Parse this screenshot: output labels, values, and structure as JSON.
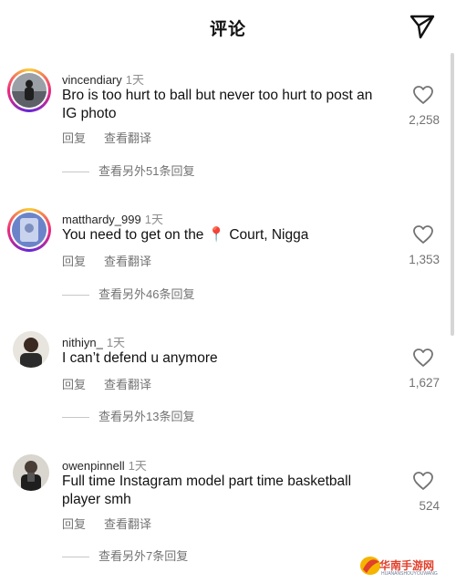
{
  "header": {
    "title": "评论"
  },
  "comments": [
    {
      "username": "vincendiary",
      "time": "1天",
      "text": "Bro is too hurt to ball but never too hurt to post an IG photo",
      "reply": "回复",
      "translate": "查看翻译",
      "likes": "2,258",
      "view_replies": "查看另外51条回复"
    },
    {
      "username": "matthardy_999",
      "time": "1天",
      "text": "You need to get on the 📍 Court, Nigga",
      "reply": "回复",
      "translate": "查看翻译",
      "likes": "1,353",
      "view_replies": "查看另外46条回复"
    },
    {
      "username": "nithiyn_",
      "time": "1天",
      "text": "I can’t defend u anymore",
      "reply": "回复",
      "translate": "查看翻译",
      "likes": "1,627",
      "view_replies": "查看另外13条回复"
    },
    {
      "username": "owenpinnell",
      "time": "1天",
      "text": "Full time Instagram model part time basketball player smh",
      "reply": "回复",
      "translate": "查看翻译",
      "likes": "524",
      "view_replies": "查看另外7条回复"
    }
  ],
  "watermark": {
    "text": "华南手游网",
    "sub": "HUANANSHOUYOUWANG"
  },
  "colors": {
    "ring_start": "#f9ce34",
    "ring_mid": "#ee2a7b",
    "ring_end": "#6228d7",
    "secondary_text": "#737373"
  }
}
